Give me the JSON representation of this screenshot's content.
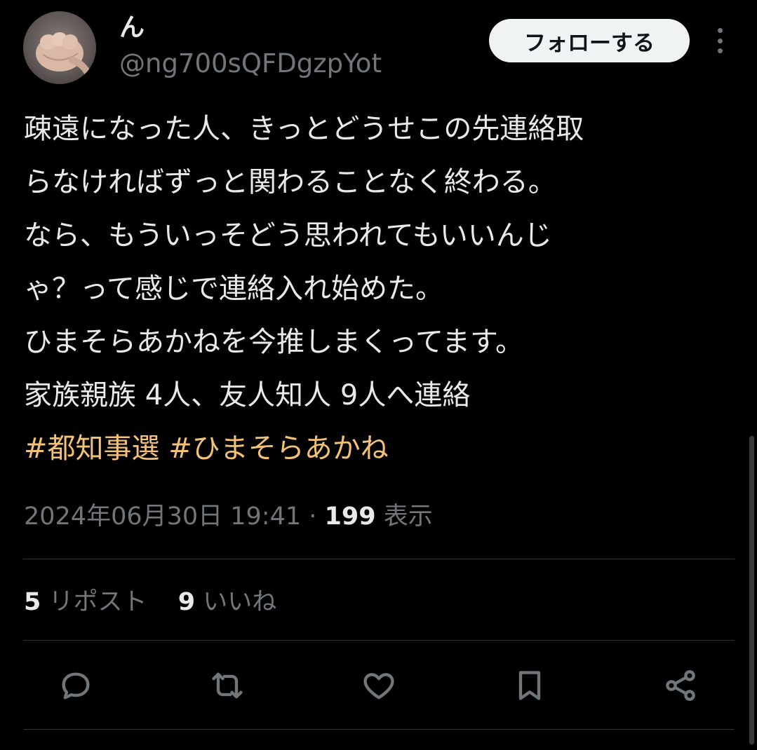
{
  "author": {
    "display_name": "ん",
    "handle": "@ng700sQFDgzpYot"
  },
  "follow_label": "フォローする",
  "tweet": {
    "lines": [
      "疎遠になった人、きっとどうせこの先連絡取",
      "らなければずっと関わることなく終わる。",
      "なら、もういっそどう思われてもいいんじ",
      "ゃ？って感じで連絡入れ始めた。",
      "ひまそらあかねを今推しまくってます。",
      "家族親族 4人、友人知人 9人へ連絡"
    ],
    "hashtags": [
      "#都知事選",
      "#ひまそらあかね"
    ]
  },
  "meta": {
    "timestamp": "2024年06月30日 19:41",
    "separator": "·",
    "views_count": "199",
    "views_label": "表示"
  },
  "stats": {
    "reposts_count": "5",
    "reposts_label": "リポスト",
    "likes_count": "9",
    "likes_label": "いいね"
  },
  "colors": {
    "background": "#000000",
    "text": "#e7e9ea",
    "secondary": "#71767b",
    "hashtag": "#f3c277",
    "divider": "#2f3336"
  },
  "icons": [
    "reply-icon",
    "repost-icon",
    "like-icon",
    "bookmark-icon",
    "share-icon",
    "more-icon"
  ]
}
